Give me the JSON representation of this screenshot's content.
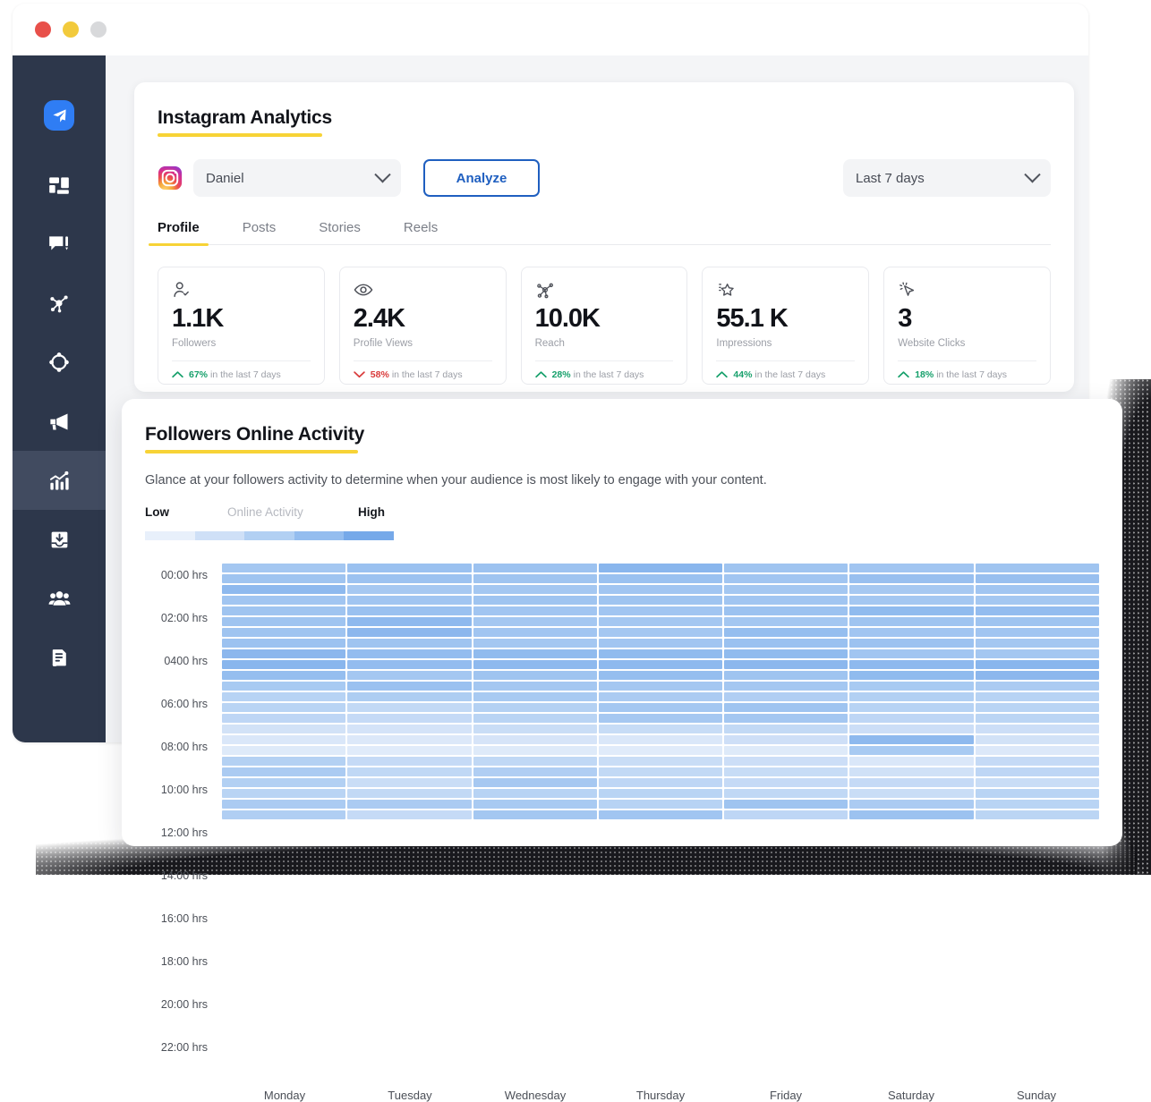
{
  "window": {
    "buttons": [
      {
        "name": "close",
        "color": "#e8504a"
      },
      {
        "name": "minimize",
        "color": "#f2ca3c"
      },
      {
        "name": "maximize",
        "color": "#d8d9db"
      }
    ]
  },
  "sidebar": {
    "logo": "paper-plane-icon",
    "items": [
      {
        "icon": "dashboard-grid-icon",
        "label": "Dashboard",
        "active": false
      },
      {
        "icon": "comments-compose-icon",
        "label": "Engage",
        "active": false
      },
      {
        "icon": "network-share-icon",
        "label": "Publish",
        "active": false
      },
      {
        "icon": "target-nodes-icon",
        "label": "Discovery",
        "active": false
      },
      {
        "icon": "megaphone-icon",
        "label": "Campaigns",
        "active": false
      },
      {
        "icon": "analytics-chart-icon",
        "label": "Analytics",
        "active": true
      },
      {
        "icon": "inbox-download-icon",
        "label": "Inbox",
        "active": false
      },
      {
        "icon": "people-group-icon",
        "label": "Audience",
        "active": false
      },
      {
        "icon": "document-report-icon",
        "label": "Reports",
        "active": false
      }
    ]
  },
  "analytics": {
    "title": "Instagram Analytics",
    "account": {
      "platform_icon": "instagram-icon",
      "selected": "Daniel",
      "chevron": "chevron-down-icon"
    },
    "analyze_label": "Analyze",
    "date_range": {
      "selected": "Last 7 days",
      "chevron": "chevron-down-icon"
    },
    "tabs": [
      {
        "label": "Profile",
        "active": true
      },
      {
        "label": "Posts",
        "active": false
      },
      {
        "label": "Stories",
        "active": false
      },
      {
        "label": "Reels",
        "active": false
      }
    ],
    "stats": [
      {
        "icon": "user-check-icon",
        "value": "1.1K",
        "label": "Followers",
        "pct": "67%",
        "suffix": "in the last 7 days",
        "direction": "up",
        "color": "#16a06b"
      },
      {
        "icon": "eye-icon",
        "value": "2.4K",
        "label": "Profile Views",
        "pct": "58%",
        "suffix": "in the last 7 days",
        "direction": "down",
        "color": "#d93a3a"
      },
      {
        "icon": "share-nodes-icon",
        "value": "10.0K",
        "label": "Reach",
        "pct": "28%",
        "suffix": "in the last 7 days",
        "direction": "up",
        "color": "#16a06b"
      },
      {
        "icon": "star-burst-icon",
        "value": "55.1 K",
        "label": "Impressions",
        "pct": "44%",
        "suffix": "in the last 7 days",
        "direction": "up",
        "color": "#16a06b"
      },
      {
        "icon": "cursor-click-icon",
        "value": "3",
        "label": "Website Clicks",
        "pct": "18%",
        "suffix": "in the last 7 days",
        "direction": "up",
        "color": "#16a06b"
      }
    ]
  },
  "activity": {
    "title": "Followers Online Activity",
    "description": "Glance at your followers activity to determine when your audience is most likely to engage with your content.",
    "legend": {
      "low": "Low",
      "middle": "Online Activity",
      "high": "High",
      "colors": [
        "#e8f0fb",
        "#cfe0f7",
        "#b2d0f3",
        "#94bdef",
        "#76a9e9"
      ]
    }
  },
  "chart_data": {
    "type": "heatmap",
    "title": "Followers Online Activity",
    "xlabel": "",
    "ylabel": "",
    "grid": false,
    "legend_position": "top-left",
    "colorscale": [
      "#e8f0fb",
      "#cfe0f7",
      "#b2d0f3",
      "#94bdef",
      "#76a9e9"
    ],
    "value_range": [
      0,
      100
    ],
    "categories": [
      "Monday",
      "Tuesday",
      "Wednesday",
      "Thursday",
      "Friday",
      "Saturday",
      "Sunday"
    ],
    "y_labels": [
      "00:00 hrs",
      "",
      "02:00 hrs",
      "",
      "0400 hrs",
      "",
      "06:00 hrs",
      "",
      "08:00 hrs",
      "",
      "10:00 hrs",
      "",
      "12:00 hrs",
      "",
      "14:00 hrs",
      "",
      "16:00 hrs",
      "",
      "18:00 hrs",
      "",
      "20:00 hrs",
      "",
      "22:00 hrs",
      ""
    ],
    "y_tick_labels": [
      "00:00 hrs",
      "02:00 hrs",
      "0400 hrs",
      "06:00 hrs",
      "08:00 hrs",
      "10:00 hrs",
      "12:00 hrs",
      "14:00 hrs",
      "16:00 hrs",
      "18:00 hrs",
      "20:00 hrs",
      "22:00 hrs"
    ],
    "hours": [
      "00:00",
      "01:00",
      "02:00",
      "03:00",
      "04:00",
      "05:00",
      "06:00",
      "07:00",
      "08:00",
      "09:00",
      "10:00",
      "11:00",
      "12:00",
      "13:00",
      "14:00",
      "15:00",
      "16:00",
      "17:00",
      "18:00",
      "19:00",
      "20:00",
      "21:00",
      "22:00",
      "23:00"
    ],
    "series": [
      {
        "name": "Monday",
        "values": [
          62,
          66,
          80,
          64,
          66,
          66,
          66,
          68,
          82,
          84,
          74,
          58,
          46,
          44,
          40,
          22,
          14,
          10,
          48,
          56,
          50,
          44,
          56,
          52
        ]
      },
      {
        "name": "Tuesday",
        "values": [
          70,
          68,
          60,
          64,
          70,
          80,
          82,
          66,
          76,
          76,
          62,
          70,
          54,
          36,
          34,
          20,
          12,
          8,
          34,
          38,
          30,
          36,
          56,
          34
        ]
      },
      {
        "name": "Wednesday",
        "values": [
          68,
          66,
          62,
          66,
          64,
          62,
          64,
          62,
          78,
          80,
          66,
          62,
          58,
          48,
          44,
          30,
          18,
          10,
          38,
          52,
          60,
          46,
          58,
          62
        ]
      },
      {
        "name": "Thursday",
        "values": [
          84,
          70,
          64,
          66,
          64,
          62,
          62,
          64,
          78,
          80,
          74,
          62,
          56,
          62,
          60,
          32,
          14,
          8,
          30,
          36,
          40,
          44,
          46,
          64
        ]
      },
      {
        "name": "Friday",
        "values": [
          66,
          64,
          62,
          64,
          68,
          62,
          74,
          70,
          78,
          82,
          66,
          62,
          52,
          66,
          62,
          36,
          26,
          10,
          28,
          32,
          34,
          38,
          66,
          40
        ]
      },
      {
        "name": "Saturday",
        "values": [
          64,
          72,
          60,
          62,
          78,
          66,
          64,
          68,
          64,
          80,
          78,
          58,
          50,
          46,
          40,
          28,
          80,
          58,
          14,
          24,
          34,
          30,
          56,
          68
        ]
      },
      {
        "name": "Sunday",
        "values": [
          66,
          72,
          64,
          62,
          76,
          66,
          64,
          62,
          62,
          84,
          82,
          56,
          46,
          44,
          42,
          28,
          22,
          12,
          34,
          40,
          30,
          44,
          44,
          42
        ]
      }
    ]
  }
}
